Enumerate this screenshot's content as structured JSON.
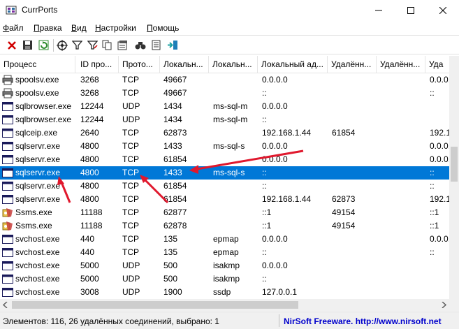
{
  "window": {
    "title": "CurrPorts"
  },
  "menu": [
    {
      "acc": "Ф",
      "rest": "айл"
    },
    {
      "acc": "П",
      "rest": "равка"
    },
    {
      "acc": "В",
      "rest": "ид"
    },
    {
      "acc": "Н",
      "rest": "астройки"
    },
    {
      "acc": "П",
      "rest": "омощь"
    }
  ],
  "toolbar_icons": [
    "close-connection-icon",
    "save-icon",
    "refresh-icon",
    "target-icon",
    "filter-icon",
    "filter-edit-icon",
    "copy-icon",
    "properties-icon",
    "find-icon",
    "html-report-icon",
    "exit-icon"
  ],
  "columns": [
    "Процесс",
    "ID про...",
    "Прото...",
    "Локальн...",
    "Локальн...",
    "Локальный ад...",
    "Удалённ...",
    "Удалённ...",
    "Уда"
  ],
  "rows": [
    {
      "icon": "printer-icon",
      "cells": [
        "spoolsv.exe",
        "3268",
        "TCP",
        "49667",
        "",
        "0.0.0.0",
        "",
        "",
        "0.0.0."
      ]
    },
    {
      "icon": "printer-icon",
      "cells": [
        "spoolsv.exe",
        "3268",
        "TCP",
        "49667",
        "",
        "::",
        "",
        "",
        "::"
      ]
    },
    {
      "icon": "window-icon",
      "cells": [
        "sqlbrowser.exe",
        "12244",
        "UDP",
        "1434",
        "ms-sql-m",
        "0.0.0.0",
        "",
        "",
        ""
      ]
    },
    {
      "icon": "window-icon",
      "cells": [
        "sqlbrowser.exe",
        "12244",
        "UDP",
        "1434",
        "ms-sql-m",
        "::",
        "",
        "",
        ""
      ]
    },
    {
      "icon": "window-icon",
      "cells": [
        "sqlceip.exe",
        "2640",
        "TCP",
        "62873",
        "",
        "192.168.1.44",
        "61854",
        "",
        "192.1"
      ]
    },
    {
      "icon": "window-icon",
      "cells": [
        "sqlservr.exe",
        "4800",
        "TCP",
        "1433",
        "ms-sql-s",
        "0.0.0.0",
        "",
        "",
        "0.0.0."
      ]
    },
    {
      "icon": "window-icon",
      "cells": [
        "sqlservr.exe",
        "4800",
        "TCP",
        "61854",
        "",
        "0.0.0.0",
        "",
        "",
        "0.0.0."
      ]
    },
    {
      "icon": "window-icon",
      "cells": [
        "sqlservr.exe",
        "4800",
        "TCP",
        "1433",
        "ms-sql-s",
        "::",
        "",
        "",
        "::"
      ],
      "selected": true
    },
    {
      "icon": "window-icon",
      "cells": [
        "sqlservr.exe",
        "4800",
        "TCP",
        "61854",
        "",
        "::",
        "",
        "",
        "::"
      ]
    },
    {
      "icon": "window-icon",
      "cells": [
        "sqlservr.exe",
        "4800",
        "TCP",
        "61854",
        "",
        "192.168.1.44",
        "62873",
        "",
        "192.1"
      ]
    },
    {
      "icon": "ssms-icon",
      "cells": [
        "Ssms.exe",
        "11188",
        "TCP",
        "62877",
        "",
        "::1",
        "49154",
        "",
        "::1"
      ]
    },
    {
      "icon": "ssms-icon",
      "cells": [
        "Ssms.exe",
        "11188",
        "TCP",
        "62878",
        "",
        "::1",
        "49154",
        "",
        "::1"
      ]
    },
    {
      "icon": "window-icon",
      "cells": [
        "svchost.exe",
        "440",
        "TCP",
        "135",
        "epmap",
        "0.0.0.0",
        "",
        "",
        "0.0.0."
      ]
    },
    {
      "icon": "window-icon",
      "cells": [
        "svchost.exe",
        "440",
        "TCP",
        "135",
        "epmap",
        "::",
        "",
        "",
        "::"
      ]
    },
    {
      "icon": "window-icon",
      "cells": [
        "svchost.exe",
        "5000",
        "UDP",
        "500",
        "isakmp",
        "0.0.0.0",
        "",
        "",
        ""
      ]
    },
    {
      "icon": "window-icon",
      "cells": [
        "svchost.exe",
        "5000",
        "UDP",
        "500",
        "isakmp",
        "::",
        "",
        "",
        ""
      ]
    },
    {
      "icon": "window-icon",
      "cells": [
        "svchost.exe",
        "3008",
        "UDP",
        "1900",
        "ssdp",
        "127.0.0.1",
        "",
        "",
        ""
      ]
    }
  ],
  "status": {
    "text": "Элементов: 116, 26 удалённых соединений, выбрано: 1",
    "link": "NirSoft Freeware.  http://www.nirsoft.net"
  },
  "colors": {
    "selection": "#0078d7",
    "annotation_arrow": "#e0182d",
    "link": "#0000cc"
  }
}
